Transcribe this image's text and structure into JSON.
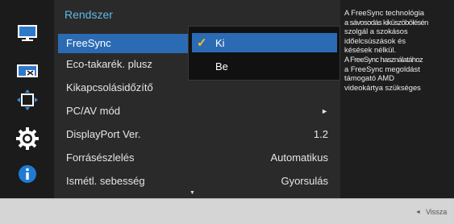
{
  "menu": {
    "title": "Rendszer",
    "items": [
      {
        "label": "FreeSync",
        "value": ""
      },
      {
        "label": "Eco-takarék. plusz",
        "value": ""
      },
      {
        "label": "Kikapcsolásidőzítő",
        "value": ""
      },
      {
        "label": "PC/AV mód",
        "value": "►"
      },
      {
        "label": "DisplayPort Ver.",
        "value": "1.2"
      },
      {
        "label": "Forrásészlelés",
        "value": "Automatikus"
      },
      {
        "label": "Ismétl. sebesség",
        "value": "Gyorsulás"
      }
    ],
    "scroll_indicator": "▼"
  },
  "dropdown": {
    "options": [
      {
        "label": "Ki",
        "check": "✓"
      },
      {
        "label": "Be",
        "check": ""
      }
    ]
  },
  "help": {
    "lines": [
      "A FreeSync technológia",
      "a sávosodás kiküszöbölésén",
      "szolgál a szokásos",
      "időelcsúszások és",
      "késések nélkül.",
      "A FreeSync használatához",
      "a FreeSync megoldást",
      "támogató AMD",
      "videokártya szükséges"
    ]
  },
  "footer": {
    "back_icon": "◄",
    "back_label": "Vissza"
  },
  "icons": [
    "monitor-icon",
    "picture-size-icon",
    "position-arrows-icon",
    "gear-icon",
    "info-icon"
  ],
  "colors": {
    "accent": "#61b7e8",
    "selection": "#2b6bb3",
    "check": "#f6c21c"
  }
}
